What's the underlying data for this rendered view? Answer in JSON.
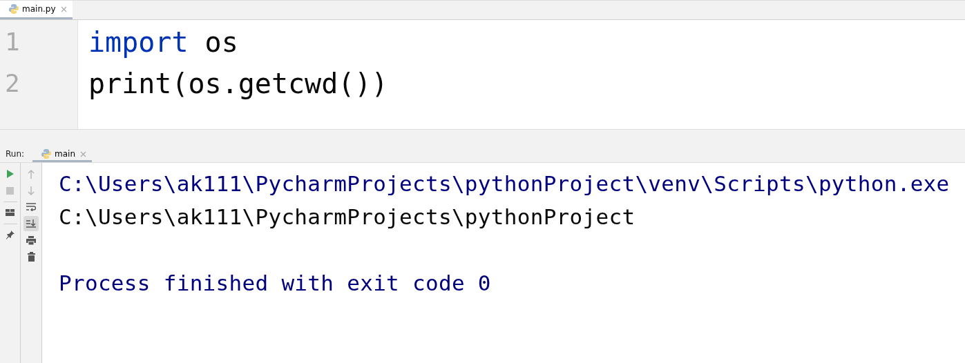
{
  "editor_tabs": [
    {
      "label": "main.py",
      "selected": true
    }
  ],
  "editor": {
    "lines": [
      {
        "number": "1",
        "tokens": [
          {
            "kind": "keyword",
            "text": "import"
          },
          {
            "kind": "plain",
            "text": " os"
          }
        ]
      },
      {
        "number": "2",
        "tokens": [
          {
            "kind": "plain",
            "text": "print(os.getcwd())"
          }
        ]
      }
    ]
  },
  "run_panel": {
    "label": "Run:",
    "tabs": [
      {
        "label": "main",
        "selected": true
      }
    ],
    "left_tools": [
      {
        "kind": "run",
        "disabled": false
      },
      {
        "kind": "stop",
        "disabled": true
      },
      {
        "kind": "layout",
        "disabled": false
      },
      {
        "kind": "pin",
        "disabled": false
      }
    ],
    "right_tools": [
      {
        "kind": "up",
        "disabled": true,
        "selected": false
      },
      {
        "kind": "down",
        "disabled": true,
        "selected": false
      },
      {
        "kind": "wrap",
        "disabled": false,
        "selected": false
      },
      {
        "kind": "scroll-end",
        "disabled": false,
        "selected": true
      },
      {
        "kind": "print",
        "disabled": false,
        "selected": false
      },
      {
        "kind": "trash",
        "disabled": false,
        "selected": false
      }
    ],
    "console": [
      {
        "kind": "system",
        "text": "C:\\Users\\ak111\\PycharmProjects\\pythonProject\\venv\\Scripts\\python.exe"
      },
      {
        "kind": "output",
        "text": "C:\\Users\\ak111\\PycharmProjects\\pythonProject"
      },
      {
        "kind": "blank"
      },
      {
        "kind": "system",
        "text": "Process finished with exit code 0"
      }
    ]
  }
}
